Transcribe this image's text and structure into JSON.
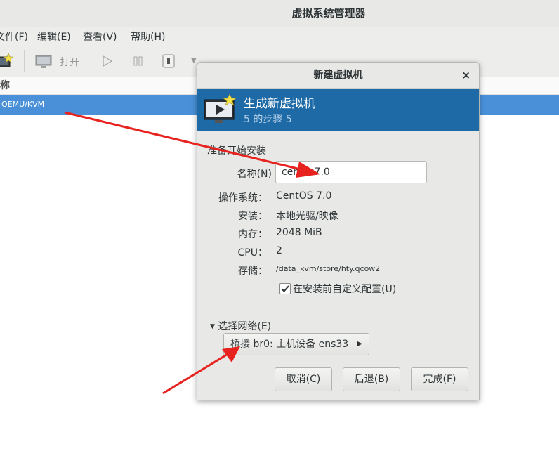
{
  "app": {
    "title": "虚拟系统管理器"
  },
  "menu": [
    "文件(F)",
    "编辑(E)",
    "查看(V)",
    "帮助(H)"
  ],
  "toolbar": {
    "open_label": "打开"
  },
  "list": {
    "column_name": "名称",
    "row": "QEMU/KVM"
  },
  "dialog": {
    "title": "新建虚拟机",
    "close": "×",
    "banner_title": "生成新虚拟机",
    "banner_step": "5 的步骤 5",
    "section": "准备开始安装",
    "name_label": "名称(N)",
    "name_value": "centos7.0",
    "os_label": "操作系统：",
    "os_value": "CentOS 7.0",
    "install_label": "安装：",
    "install_value": "本地光驱/映像",
    "memory_label": "内存：",
    "memory_value": "2048 MiB",
    "cpu_label": "CPU：",
    "cpu_value": "2",
    "storage_label": "存储：",
    "storage_value": "/data_kvm/store/hty.qcow2",
    "customize_label": "在安装前自定义配置(U)",
    "customize_checked": true,
    "network_expander": "选择网络(E)",
    "network_value": "桥接 br0: 主机设备 ens33",
    "buttons": {
      "cancel": "取消(C)",
      "back": "后退(B)",
      "finish": "完成(F)"
    }
  },
  "colors": {
    "accent": "#1e6aa6",
    "selection": "#4a90d9",
    "arrow": "#e8231f"
  }
}
